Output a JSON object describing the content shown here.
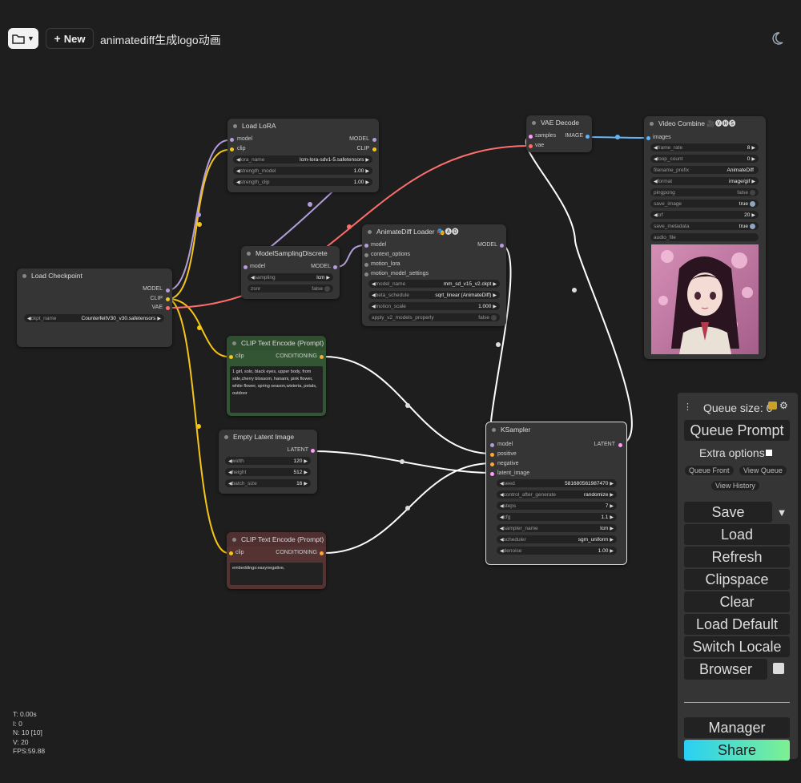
{
  "topbar": {
    "new_label": "New",
    "workflow_title": "animatediff生成logo动画"
  },
  "nodes": {
    "load_lora": {
      "title": "Load LoRA",
      "in_model": "model",
      "in_clip": "clip",
      "out_model": "MODEL",
      "out_clip": "CLIP",
      "w1_name": "lora_name",
      "w1_val": "lcm-lora-sdv1-5.safetensors",
      "w2_name": "strength_model",
      "w2_val": "1.00",
      "w3_name": "strength_clip",
      "w3_val": "1.00"
    },
    "vae_decode": {
      "title": "VAE Decode",
      "in_samples": "samples",
      "in_vae": "vae",
      "out_image": "IMAGE"
    },
    "video_combine": {
      "title": "Video Combine 🎥🅥🅗🅢",
      "in_images": "images",
      "w1_name": "frame_rate",
      "w1_val": "8",
      "w2_name": "loop_count",
      "w2_val": "0",
      "w3_name": "filename_prefix",
      "w3_val": "AnimateDiff",
      "w4_name": "format",
      "w4_val": "image/gif",
      "w5_name": "pingpong",
      "w5_val": "false",
      "w6_name": "save_image",
      "w6_val": "true",
      "w7_name": "crf",
      "w7_val": "20",
      "w8_name": "save_metadata",
      "w8_val": "true",
      "w9_name": "audio_file"
    },
    "load_checkpoint": {
      "title": "Load Checkpoint",
      "out_model": "MODEL",
      "out_clip": "CLIP",
      "out_vae": "VAE",
      "w1_name": "ckpt_name",
      "w1_val": "CounterfeitV30_v30.safetensors"
    },
    "model_sampling": {
      "title": "ModelSamplingDiscrete",
      "in_model": "model",
      "out_model": "MODEL",
      "w1_name": "sampling",
      "w1_val": "lcm",
      "w2_name": "zsnr",
      "w2_val": "false"
    },
    "animatediff_loader": {
      "title": "AnimateDiff Loader 🎭🅐🅓",
      "in_model": "model",
      "in_context": "context_options",
      "in_motion_lora": "motion_lora",
      "in_motion_settings": "motion_model_settings",
      "out_model": "MODEL",
      "w1_name": "model_name",
      "w1_val": "mm_sd_v15_v2.ckpt",
      "w2_name": "beta_schedule",
      "w2_val": "sqrt_linear (AnimateDiff)",
      "w3_name": "motion_scale",
      "w3_val": "1.000",
      "w4_name": "apply_v2_models_properly",
      "w4_val": "false"
    },
    "clip_pos": {
      "title": "CLIP Text Encode (Prompt)",
      "in_clip": "clip",
      "out_cond": "CONDITIONING",
      "text": "1 girl, solo, black eyes, upper body, from side,cherry blossom, hanami, pink flower, white flower, spring season,wisteria, petals, outdoor"
    },
    "empty_latent": {
      "title": "Empty Latent Image",
      "out_latent": "LATENT",
      "w1_name": "width",
      "w1_val": "120",
      "w2_name": "height",
      "w2_val": "512",
      "w3_name": "batch_size",
      "w3_val": "16"
    },
    "clip_neg": {
      "title": "CLIP Text Encode (Prompt)",
      "in_clip": "clip",
      "out_cond": "CONDITIONING",
      "text": "embeddings:easynegative,"
    },
    "ksampler": {
      "title": "KSampler",
      "in_model": "model",
      "in_positive": "positive",
      "in_negative": "negative",
      "in_latent": "latent_image",
      "out_latent": "LATENT",
      "w1_name": "seed",
      "w1_val": "581680561987470",
      "w2_name": "control_after_generate",
      "w2_val": "randomize",
      "w3_name": "steps",
      "w3_val": "7",
      "w4_name": "cfg",
      "w4_val": "1.1",
      "w5_name": "sampler_name",
      "w5_val": "lcm",
      "w6_name": "scheduler",
      "w6_val": "sgm_uniform",
      "w7_name": "denoise",
      "w7_val": "1.00"
    }
  },
  "stats": {
    "t": "T: 0.00s",
    "i": "I: 0",
    "n": "N: 10 [10]",
    "v": "V: 20",
    "fps": "FPS:59.88"
  },
  "menu": {
    "queue_size": "Queue size: 0",
    "queue_prompt": "Queue Prompt",
    "extra_options": "Extra options",
    "queue_front": "Queue Front",
    "view_queue": "View Queue",
    "view_history": "View History",
    "save": "Save",
    "load": "Load",
    "refresh": "Refresh",
    "clipspace": "Clipspace",
    "clear": "Clear",
    "load_default": "Load Default",
    "switch_locale": "Switch Locale",
    "browser": "Browser",
    "manager": "Manager",
    "share": "Share"
  },
  "colors": {
    "model_wire": "#b39ddb",
    "clip_wire": "#f5c518",
    "vae_wire": "#ff6e6e",
    "cond_wire": "#ffffff",
    "image_wire": "#64b5f6",
    "latent_wire": "#ff9cf9"
  }
}
